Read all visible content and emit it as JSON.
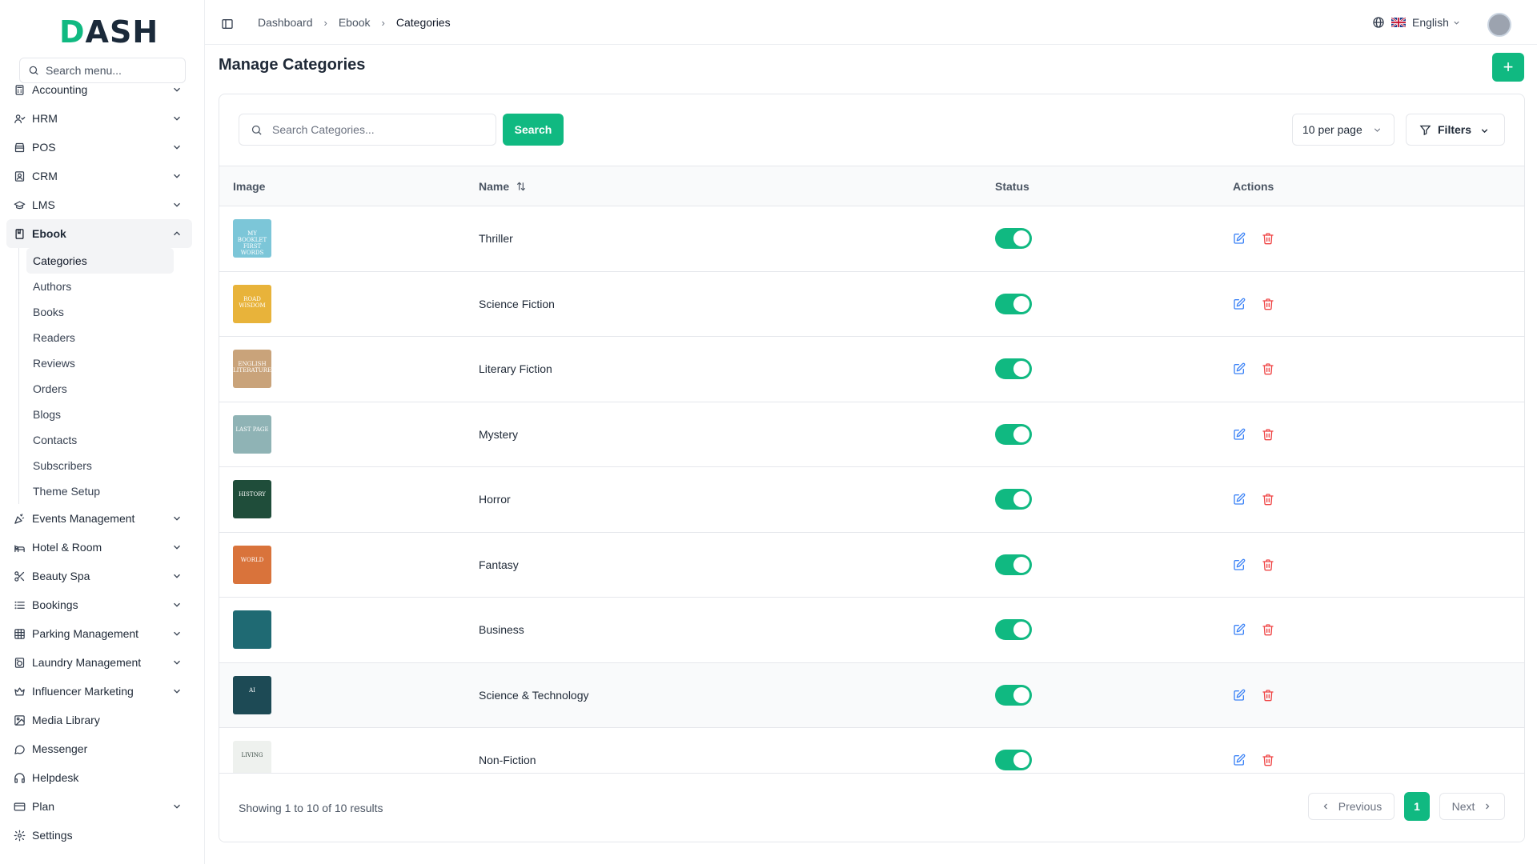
{
  "brand": {
    "logo_first": "D",
    "logo_rest": "ASH",
    "accent": "#10b981"
  },
  "sidebar": {
    "search_placeholder": "Search menu...",
    "items": [
      {
        "label": "Accounting",
        "icon": "calculator-icon",
        "has_children": true
      },
      {
        "label": "HRM",
        "icon": "users-icon",
        "has_children": true
      },
      {
        "label": "POS",
        "icon": "store-icon",
        "has_children": true
      },
      {
        "label": "CRM",
        "icon": "contact-icon",
        "has_children": true
      },
      {
        "label": "LMS",
        "icon": "graduation-cap-icon",
        "has_children": true
      },
      {
        "label": "Ebook",
        "icon": "book-icon",
        "has_children": true,
        "expanded": true
      }
    ],
    "ebook_children": [
      {
        "label": "Categories",
        "active": true
      },
      {
        "label": "Authors"
      },
      {
        "label": "Books"
      },
      {
        "label": "Readers"
      },
      {
        "label": "Reviews"
      },
      {
        "label": "Orders"
      },
      {
        "label": "Blogs"
      },
      {
        "label": "Contacts"
      },
      {
        "label": "Subscribers"
      },
      {
        "label": "Theme Setup"
      }
    ],
    "items_after": [
      {
        "label": "Events Management",
        "icon": "party-popper-icon",
        "has_children": true
      },
      {
        "label": "Hotel & Room",
        "icon": "hotel-icon",
        "has_children": true
      },
      {
        "label": "Beauty Spa",
        "icon": "scissors-icon",
        "has_children": true
      },
      {
        "label": "Bookings",
        "icon": "list-icon",
        "has_children": true
      },
      {
        "label": "Parking Management",
        "icon": "grid-icon",
        "has_children": true
      },
      {
        "label": "Laundry Management",
        "icon": "washing-machine-icon",
        "has_children": true
      },
      {
        "label": "Influencer Marketing",
        "icon": "crown-icon",
        "has_children": true
      },
      {
        "label": "Media Library",
        "icon": "image-icon",
        "has_children": false
      },
      {
        "label": "Messenger",
        "icon": "message-circle-icon",
        "has_children": false
      },
      {
        "label": "Helpdesk",
        "icon": "headphones-icon",
        "has_children": false
      },
      {
        "label": "Plan",
        "icon": "credit-card-icon",
        "has_children": true
      },
      {
        "label": "Settings",
        "icon": "gear-icon",
        "has_children": false
      }
    ]
  },
  "header": {
    "breadcrumb": [
      "Dashboard",
      "Ebook",
      "Categories"
    ],
    "language": "English"
  },
  "page": {
    "title": "Manage Categories",
    "add_button": "+"
  },
  "toolbar": {
    "search_placeholder": "Search Categories...",
    "search_button": "Search",
    "per_page": "10 per page",
    "filters_label": "Filters"
  },
  "table": {
    "columns": [
      "Image",
      "Name",
      "Status",
      "Actions"
    ],
    "rows": [
      {
        "name": "Thriller",
        "status": true,
        "cover_color": "#7cc6d8",
        "cover_text": "MY BOOKLET FIRST WORDS"
      },
      {
        "name": "Science Fiction",
        "status": true,
        "cover_color": "#e8b33a",
        "cover_text": "ROAD WISDOM"
      },
      {
        "name": "Literary Fiction",
        "status": true,
        "cover_color": "#c9a37a",
        "cover_text": "ENGLISH LITERATURE"
      },
      {
        "name": "Mystery",
        "status": true,
        "cover_color": "#8fb3b5",
        "cover_text": "LAST PAGE"
      },
      {
        "name": "Horror",
        "status": true,
        "cover_color": "#1f4d3a",
        "cover_text": "HISTORY"
      },
      {
        "name": "Fantasy",
        "status": true,
        "cover_color": "#d9733b",
        "cover_text": "WORLD"
      },
      {
        "name": "Business",
        "status": true,
        "cover_color": "#1f6a73",
        "cover_text": ""
      },
      {
        "name": "Science & Technology",
        "status": true,
        "cover_color": "#1d4a55",
        "cover_text": "AI"
      },
      {
        "name": "Non-Fiction",
        "status": true,
        "cover_color": "#eef1ee",
        "cover_text": "LIVING"
      }
    ]
  },
  "pagination": {
    "summary": "Showing 1 to 10 of 10 results",
    "previous": "Previous",
    "current": "1",
    "next": "Next"
  }
}
